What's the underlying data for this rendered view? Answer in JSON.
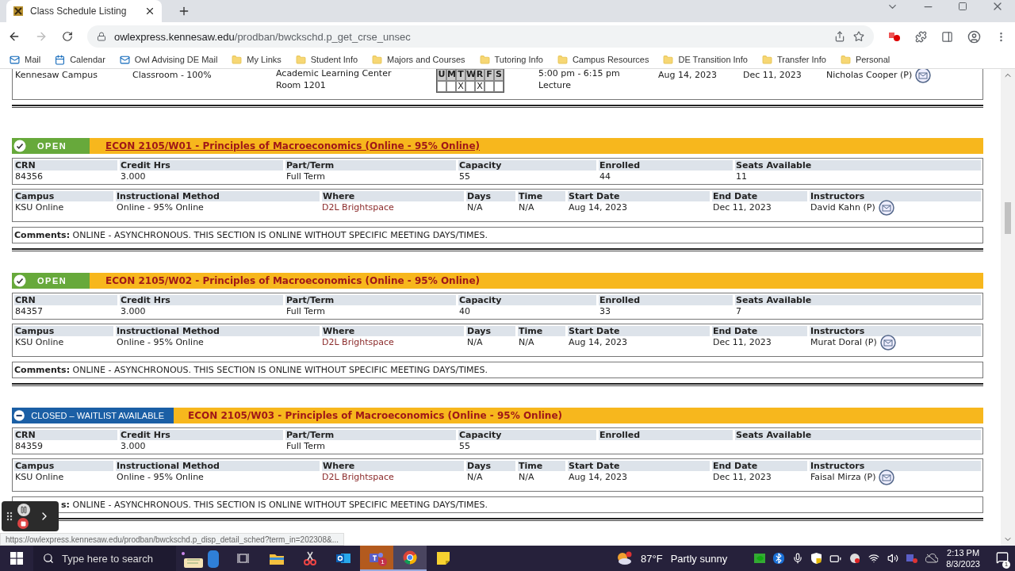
{
  "browser": {
    "tab_title": "Class Schedule Listing",
    "url_host": "owlexpress.kennesaw.edu",
    "url_path": "/prodban/bwckschd.p_get_crse_unsec",
    "bookmarks": [
      {
        "kind": "mail",
        "label": "Mail"
      },
      {
        "kind": "calendar",
        "label": "Calendar"
      },
      {
        "kind": "mail",
        "label": "Owl Advising DE Mail"
      },
      {
        "kind": "folder",
        "label": "My Links"
      },
      {
        "kind": "folder",
        "label": "Student Info"
      },
      {
        "kind": "folder",
        "label": "Majors and Courses"
      },
      {
        "kind": "folder",
        "label": "Tutoring Info"
      },
      {
        "kind": "folder",
        "label": "Campus Resources"
      },
      {
        "kind": "folder",
        "label": "DE Transition Info"
      },
      {
        "kind": "folder",
        "label": "Transfer Info"
      },
      {
        "kind": "folder",
        "label": "Personal"
      }
    ]
  },
  "previous_section": {
    "campus": "Kennesaw Campus",
    "method": "Classroom - 100%",
    "where": [
      "Academic Learning Center",
      "Room 1201"
    ],
    "days": [
      {
        "letter": "U"
      },
      {
        "letter": "M"
      },
      {
        "letter": "T",
        "mark": "X"
      },
      {
        "letter": "W"
      },
      {
        "letter": "R",
        "mark": "X"
      },
      {
        "letter": "F"
      },
      {
        "letter": "S"
      }
    ],
    "time": [
      "5:00 pm - 6:15 pm",
      "Lecture"
    ],
    "start": "Aug 14, 2023",
    "end": "Dec 11, 2023",
    "instructor": "Nicholas Cooper (P)"
  },
  "sections": [
    {
      "kind": "open",
      "status_label": "OPEN",
      "title": "ECON 2105/W01 - Principles of Macroeconomics (Online - 95% Online)",
      "hovered": true,
      "info": [
        {
          "label": "CRN",
          "value": "84356"
        },
        {
          "label": "Credit Hrs",
          "value": "3.000"
        },
        {
          "label": "Part/Term",
          "value": "Full Term"
        },
        {
          "label": "Capacity",
          "value": "55"
        },
        {
          "label": "Enrolled",
          "value": "44"
        },
        {
          "label": "Seats Available",
          "value": "11"
        }
      ],
      "details": [
        {
          "label": "Campus",
          "value": "KSU Online"
        },
        {
          "label": "Instructional Method",
          "value": "Online - 95% Online"
        },
        {
          "label": "Where",
          "value": "D2L Brightspace",
          "kind": "link"
        },
        {
          "label": "Days",
          "value": "N/A"
        },
        {
          "label": "Time",
          "value": "N/A"
        },
        {
          "label": "Start Date",
          "value": "Aug 14, 2023"
        },
        {
          "label": "End Date",
          "value": "Dec 11, 2023"
        },
        {
          "label": "Instructors",
          "value": "David Kahn (P)",
          "kind": "instructor"
        }
      ],
      "comments_label": "Comments:",
      "comments": "ONLINE - ASYNCHRONOUS. THIS SECTION IS ONLINE WITHOUT SPECIFIC MEETING DAYS/TIMES."
    },
    {
      "kind": "open",
      "status_label": "OPEN",
      "title": "ECON 2105/W02 - Principles of Macroeconomics (Online - 95% Online)",
      "hovered": false,
      "info": [
        {
          "label": "CRN",
          "value": "84357"
        },
        {
          "label": "Credit Hrs",
          "value": "3.000"
        },
        {
          "label": "Part/Term",
          "value": "Full Term"
        },
        {
          "label": "Capacity",
          "value": "40"
        },
        {
          "label": "Enrolled",
          "value": "33"
        },
        {
          "label": "Seats Available",
          "value": "7"
        }
      ],
      "details": [
        {
          "label": "Campus",
          "value": "KSU Online"
        },
        {
          "label": "Instructional Method",
          "value": "Online - 95% Online"
        },
        {
          "label": "Where",
          "value": "D2L Brightspace",
          "kind": "link"
        },
        {
          "label": "Days",
          "value": "N/A"
        },
        {
          "label": "Time",
          "value": "N/A"
        },
        {
          "label": "Start Date",
          "value": "Aug 14, 2023"
        },
        {
          "label": "End Date",
          "value": "Dec 11, 2023"
        },
        {
          "label": "Instructors",
          "value": "Murat Doral (P)",
          "kind": "instructor"
        }
      ],
      "comments_label": "Comments:",
      "comments": "ONLINE - ASYNCHRONOUS. THIS SECTION IS ONLINE WITHOUT SPECIFIC MEETING DAYS/TIMES."
    },
    {
      "kind": "closed",
      "status_label": "CLOSED – WAITLIST AVAILABLE",
      "title": "ECON 2105/W03 - Principles of Macroeconomics (Online - 95% Online)",
      "hovered": false,
      "info": [
        {
          "label": "CRN",
          "value": "84359"
        },
        {
          "label": "Credit Hrs",
          "value": "3.000"
        },
        {
          "label": "Part/Term",
          "value": "Full Term"
        },
        {
          "label": "Capacity",
          "value": "55"
        },
        {
          "label": "Enrolled"
        },
        {
          "label": "Seats Available"
        }
      ],
      "details": [
        {
          "label": "Campus",
          "value": "KSU Online"
        },
        {
          "label": "Instructional Method",
          "value": "Online - 95% Online"
        },
        {
          "label": "Where",
          "value": "D2L Brightspace",
          "kind": "link"
        },
        {
          "label": "Days",
          "value": "N/A"
        },
        {
          "label": "Time",
          "value": "N/A"
        },
        {
          "label": "Start Date",
          "value": "Aug 14, 2023"
        },
        {
          "label": "End Date",
          "value": "Dec 11, 2023"
        },
        {
          "label": "Instructors",
          "value": "Faisal Mirza (P)",
          "kind": "instructor"
        }
      ],
      "comments_label": "s:",
      "comments": "ONLINE - ASYNCHRONOUS. THIS SECTION IS ONLINE WITHOUT SPECIFIC MEETING DAYS/TIMES."
    }
  ],
  "status_url": "https://owlexpress.kennesaw.edu/prodban/bwckschd.p_disp_detail_sched?term_in=202308&...",
  "taskbar": {
    "search_placeholder": "Type here to search",
    "teams_badge": "1",
    "temperature": "87°F",
    "weather": "Partly sunny",
    "time": "2:13 PM",
    "date": "8/3/2023",
    "notifications": "1"
  }
}
